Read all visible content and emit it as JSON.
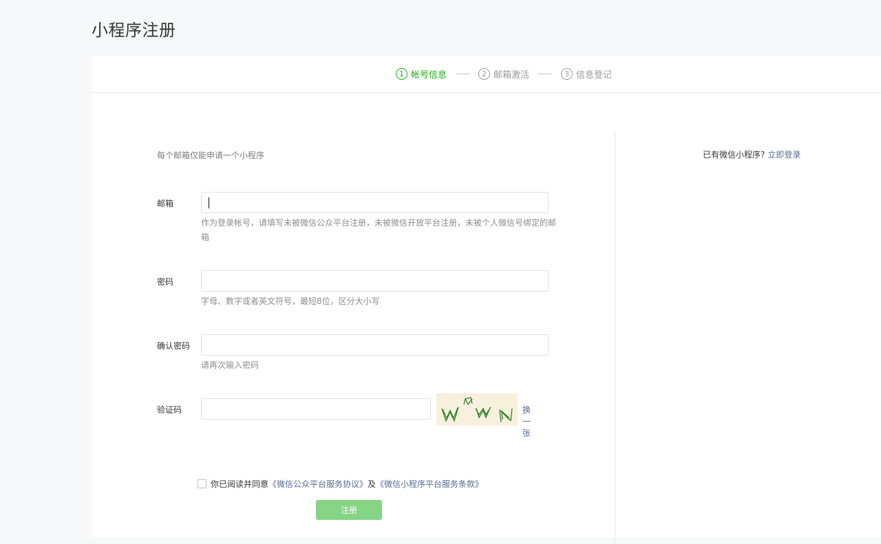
{
  "page_title": "小程序注册",
  "steps": [
    {
      "num": "1",
      "label": "帐号信息"
    },
    {
      "num": "2",
      "label": "邮箱激活"
    },
    {
      "num": "3",
      "label": "信息登记"
    }
  ],
  "notice": "每个邮箱仅能申请一个小程序",
  "login_hint": {
    "text": "已有微信小程序?",
    "link": "立即登录"
  },
  "form": {
    "email": {
      "label": "邮箱",
      "value": "",
      "tip": "作为登录帐号，请填写未被微信公众平台注册，未被微信开放平台注册，未被个人微信号绑定的邮箱"
    },
    "password": {
      "label": "密码",
      "value": "",
      "tip": "字母、数字或者英文符号，最短8位，区分大小写"
    },
    "confirm": {
      "label": "确认密码",
      "value": "",
      "tip": "请再次输入密码"
    },
    "captcha": {
      "label": "验证码",
      "value": "",
      "image_text": "WNWN",
      "refresh": "换一张"
    }
  },
  "agreement": {
    "prefix": "你已阅读并同意",
    "link1": "《微信公众平台服务协议》",
    "joiner": "及",
    "link2": "《微信小程序平台服务条款》",
    "checked": false
  },
  "register_button": "注册",
  "colors": {
    "accent": "#1aad19",
    "link": "#576b95",
    "button_disabled": "#86d486"
  }
}
